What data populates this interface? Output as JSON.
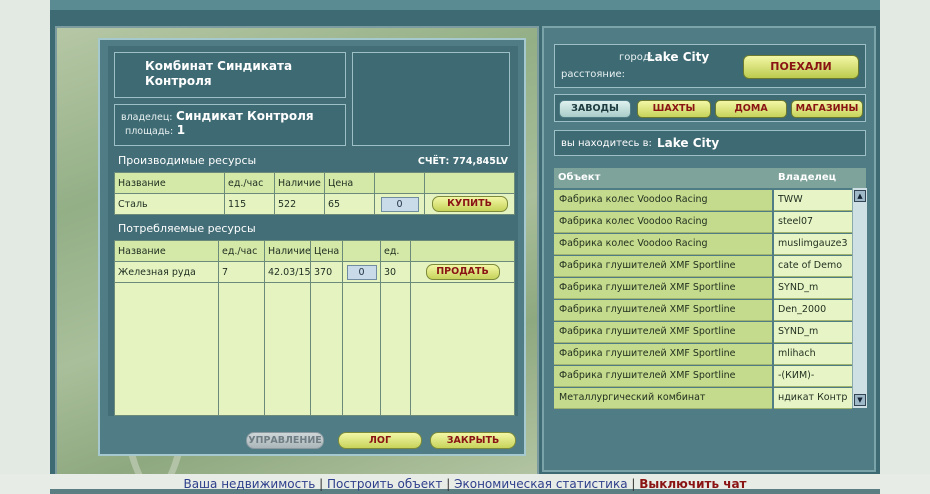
{
  "object": {
    "title": "Комбинат Синдиката Контроля",
    "owner_label": "владелец:",
    "owner_value": "Синдикат Контроля",
    "area_label": "площадь:",
    "area_value": "1"
  },
  "produced": {
    "section_title": "Производимые ресурсы",
    "account": "СЧЁТ: 774,845LV",
    "headers": [
      "Название",
      "ед./час",
      "Наличие",
      "Цена"
    ],
    "rows": [
      {
        "name": "Сталь",
        "per_hour": "115",
        "stock": "522",
        "price": "65",
        "qty": "0",
        "action": "КУПИТЬ"
      }
    ]
  },
  "consumed": {
    "section_title": "Потребляемые ресурсы",
    "headers": [
      "Название",
      "ед./час",
      "Наличие",
      "Цена",
      "",
      "ед."
    ],
    "rows": [
      {
        "name": "Железная руда",
        "per_hour": "7",
        "stock": "42.03/15",
        "price": "370",
        "qty": "0",
        "units": "30",
        "action": "ПРОДАТЬ"
      }
    ]
  },
  "bottom_buttons": {
    "manage": "УПРАВЛЕНИЕ",
    "log": "ЛОГ",
    "close": "ЗАКРЫТЬ"
  },
  "travel": {
    "city_label": "город:",
    "city_value": "Lake City",
    "distance_label": "расстояние:",
    "go_button": "ПОЕХАЛИ"
  },
  "tabs": [
    "ЗАВОДЫ",
    "ШАХТЫ",
    "ДОМА",
    "МАГАЗИНЫ"
  ],
  "location": {
    "label": "вы находитесь в:",
    "value": "Lake City"
  },
  "object_list": {
    "headers": [
      "Объект",
      "Владелец"
    ],
    "rows": [
      {
        "object": "Фабрика колес Voodoo Racing",
        "owner": "TWW"
      },
      {
        "object": "Фабрика колес Voodoo Racing",
        "owner": "steel07"
      },
      {
        "object": "Фабрика колес Voodoo Racing",
        "owner": "muslimgauze3"
      },
      {
        "object": "Фабрика глушителей XMF Sportline",
        "owner": "cate of Demo"
      },
      {
        "object": "Фабрика глушителей XMF Sportline",
        "owner": "SYND_m"
      },
      {
        "object": "Фабрика глушителей XMF Sportline",
        "owner": "Den_2000"
      },
      {
        "object": "Фабрика глушителей XMF Sportline",
        "owner": "SYND_m"
      },
      {
        "object": "Фабрика глушителей XMF Sportline",
        "owner": "mlihach"
      },
      {
        "object": "Фабрика глушителей XMF Sportline",
        "owner": "-(КИМ)-"
      },
      {
        "object": "Металлургический комбинат",
        "owner": "ндикат Контр"
      }
    ]
  },
  "footer": {
    "link1": "Ваша недвижимость",
    "link2": "Построить объект",
    "link3": "Экономическая статистика",
    "link4": "Выключить чат"
  },
  "colors": {
    "accent_text": "#8a1414",
    "button_green": "#c6d35a",
    "panel": "#4f7c85"
  }
}
